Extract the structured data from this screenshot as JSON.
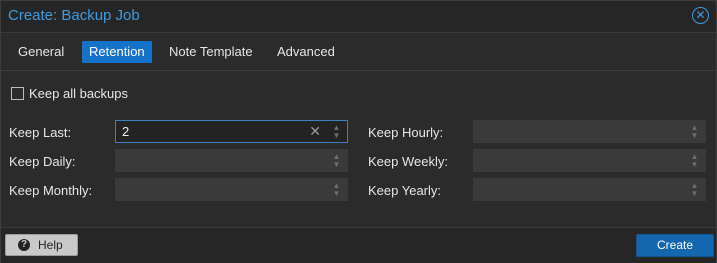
{
  "window": {
    "title": "Create: Backup Job",
    "close_icon": "close-circle-icon"
  },
  "tabs": [
    {
      "label": "General",
      "active": false
    },
    {
      "label": "Retention",
      "active": true
    },
    {
      "label": "Note Template",
      "active": false
    },
    {
      "label": "Advanced",
      "active": false
    }
  ],
  "keep_all": {
    "label": "Keep all backups",
    "checked": false
  },
  "fields": {
    "keep_last": {
      "label": "Keep Last:",
      "value": "2"
    },
    "keep_hourly": {
      "label": "Keep Hourly:",
      "value": ""
    },
    "keep_daily": {
      "label": "Keep Daily:",
      "value": ""
    },
    "keep_weekly": {
      "label": "Keep Weekly:",
      "value": ""
    },
    "keep_monthly": {
      "label": "Keep Monthly:",
      "value": ""
    },
    "keep_yearly": {
      "label": "Keep Yearly:",
      "value": ""
    }
  },
  "footer": {
    "help_label": "Help",
    "create_label": "Create"
  },
  "colors": {
    "accent": "#3d9be0",
    "tab_active": "#1473c8",
    "primary_button": "#1466ad"
  }
}
